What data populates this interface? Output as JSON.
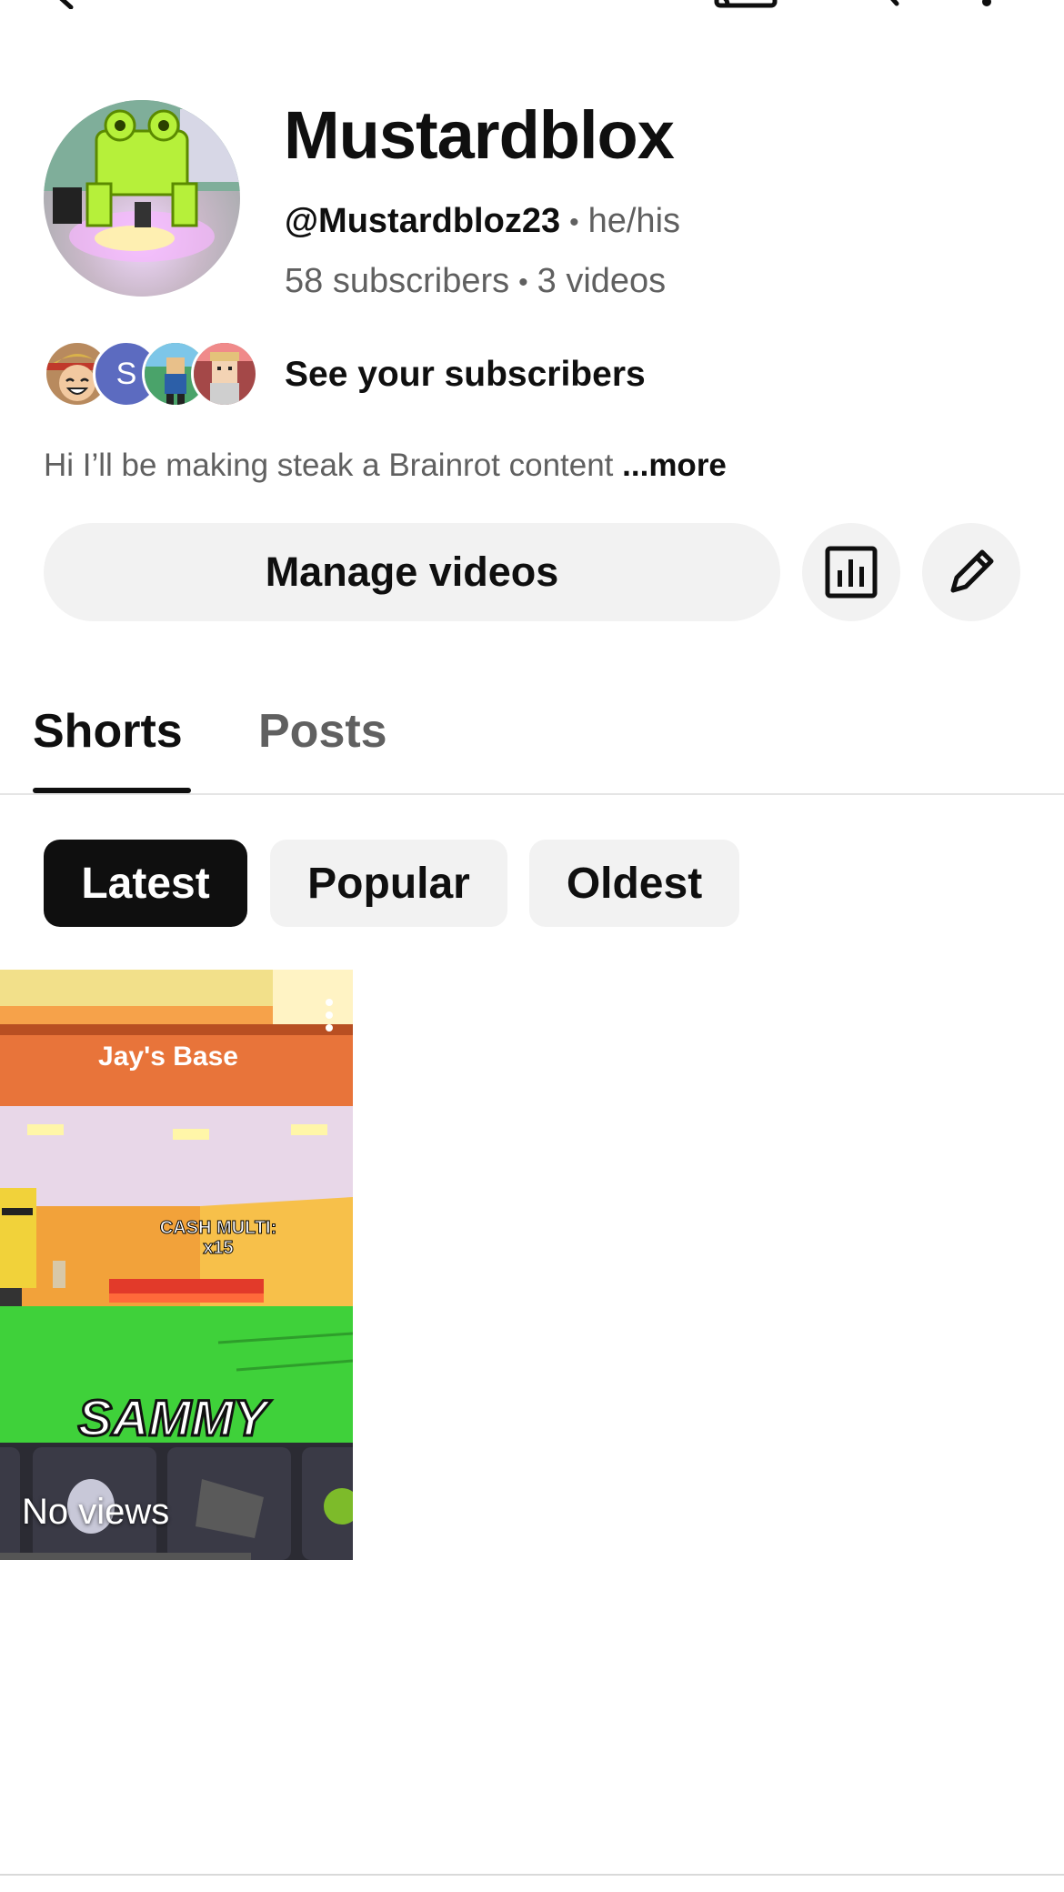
{
  "topbar": {
    "icons": [
      "back-arrow-icon",
      "cast-icon",
      "search-icon",
      "more-vertical-icon"
    ]
  },
  "channel": {
    "name": "Mustardblox",
    "handle": "@Mustardbloz23",
    "pronouns": "he/his",
    "subscribers": "58 subscribers",
    "videos": "3 videos",
    "separator": "•"
  },
  "subscribers_preview": {
    "label": "See your subscribers",
    "letter_avatar": "S"
  },
  "bio": {
    "text": "Hi I’ll be making steak a Brainrot content ",
    "more": "...more"
  },
  "actions": {
    "manage_label": "Manage videos",
    "analytics_icon": "analytics-icon",
    "edit_icon": "edit-pencil-icon"
  },
  "tabs": [
    {
      "label": "Shorts",
      "selected": true
    },
    {
      "label": "Posts",
      "selected": false
    }
  ],
  "filters": [
    {
      "label": "Latest",
      "selected": true
    },
    {
      "label": "Popular",
      "selected": false
    },
    {
      "label": "Oldest",
      "selected": false
    }
  ],
  "shorts": [
    {
      "views": "No views",
      "thumb_text_top": "Jay's Base",
      "thumb_text_mid_1": "CASH MULTI:",
      "thumb_text_mid_2": "x15",
      "thumb_text_bottom": "SAMMY"
    }
  ],
  "colors": {
    "accent_dark": "#0f0f0f",
    "secondary_text": "#606060",
    "chip_bg": "#f2f2f2"
  }
}
